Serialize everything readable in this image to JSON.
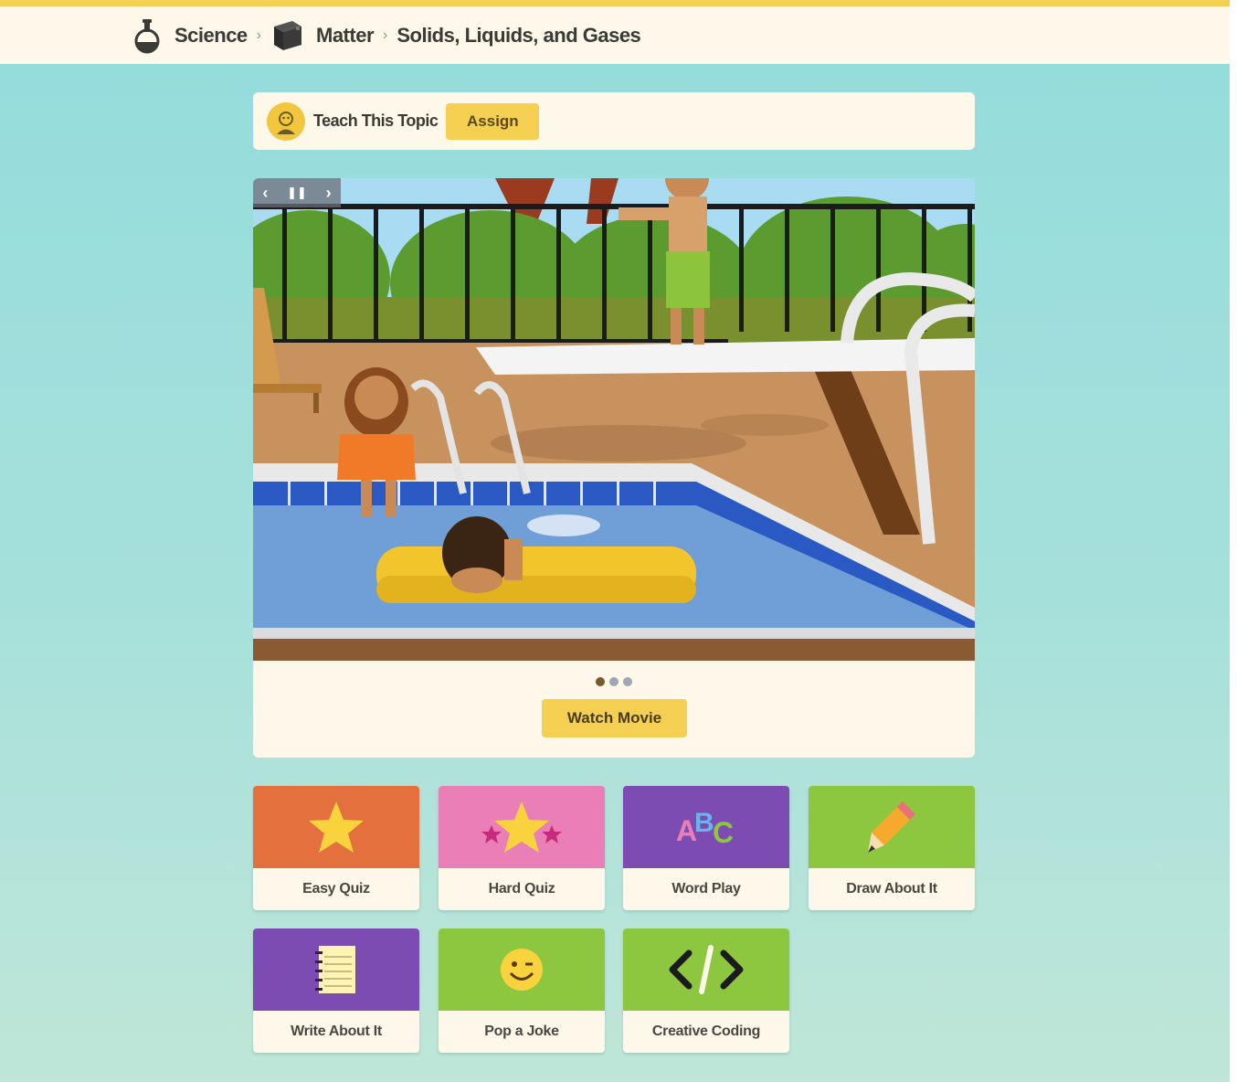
{
  "breadcrumb": {
    "items": [
      {
        "label": "Science",
        "icon": "flask-icon"
      },
      {
        "label": "Matter",
        "icon": "cube-icon"
      },
      {
        "label": "Solids, Liquids, and Gases",
        "icon": null
      }
    ],
    "separator": "›"
  },
  "teach": {
    "label": "Teach This Topic",
    "assign_label": "Assign"
  },
  "movie": {
    "controls": {
      "prev": "‹",
      "pause": "❚❚",
      "next": "›"
    },
    "slide_count": 3,
    "active_slide": 1,
    "watch_label": "Watch Movie"
  },
  "activities": [
    {
      "label": "Easy Quiz",
      "color": "#e4703d",
      "icon": "star-icon"
    },
    {
      "label": "Hard Quiz",
      "color": "#e97fb6",
      "icon": "stars-icon"
    },
    {
      "label": "Word Play",
      "color": "#7c4cb2",
      "icon": "abc-icon"
    },
    {
      "label": "Draw About It",
      "color": "#8dc63f",
      "icon": "pencil-icon"
    },
    {
      "label": "Write About It",
      "color": "#7c4cb2",
      "icon": "notepad-icon"
    },
    {
      "label": "Pop a Joke",
      "color": "#8dc63f",
      "icon": "smiley-icon"
    },
    {
      "label": "Creative Coding",
      "color": "#8dc63f",
      "icon": "code-icon"
    }
  ],
  "colors": {
    "accent_yellow": "#f4cf52",
    "cream": "#fdf8ea",
    "background_teal": "#93dcdc"
  }
}
